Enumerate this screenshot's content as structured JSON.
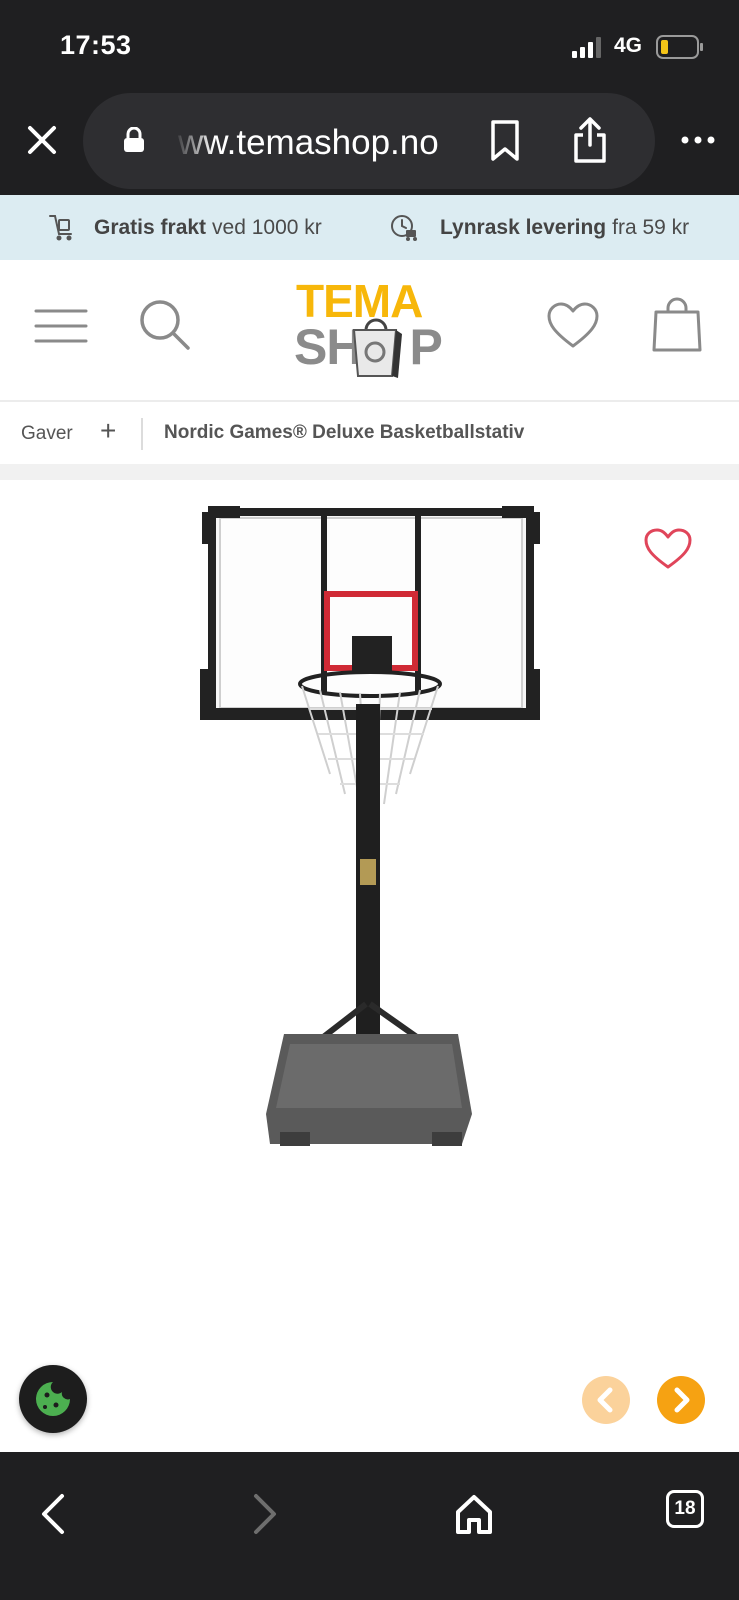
{
  "status": {
    "time": "17:53",
    "network": "4G"
  },
  "browser": {
    "url": "ww.temashop.no",
    "tab_count": "18"
  },
  "info_strip": [
    {
      "bold": "Gratis frakt",
      "text": "ved 1000 kr",
      "icon": "trolley-icon"
    },
    {
      "bold": "Lynrask levering",
      "text": "fra 59 kr",
      "icon": "fast-delivery-icon"
    }
  ],
  "logo": {
    "top": "TEMA",
    "bottom_left": "SH",
    "bottom_right": "P"
  },
  "breadcrumb": {
    "root": "Gaver",
    "expand": "+",
    "current": "Nordic Games® Deluxe Basketballstativ"
  },
  "colors": {
    "brand_yellow": "#f7b70a",
    "accent_orange": "#f6a212",
    "info_bg": "#dcecf2",
    "wishlist_red": "#e0455a",
    "cookie_green": "#4caf50"
  }
}
